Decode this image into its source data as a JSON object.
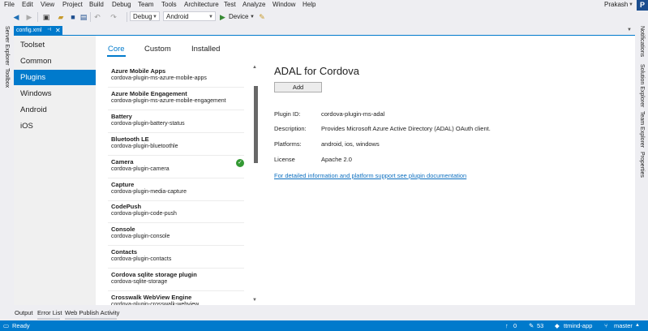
{
  "menu": [
    "File",
    "Edit",
    "View",
    "Project",
    "Build",
    "Debug",
    "Team",
    "Tools",
    "Architecture",
    "Test",
    "Analyze",
    "Window",
    "Help"
  ],
  "user": {
    "name": "Prakash",
    "badge": "P"
  },
  "toolbar": {
    "config": "Debug",
    "platform": "Android",
    "run_label": "Device"
  },
  "left_strip": [
    "Server Explorer",
    "Toolbox"
  ],
  "right_strip": [
    "Notifications",
    "Solution Explorer",
    "Team Explorer",
    "Properties"
  ],
  "doc_tab": {
    "label": "config.xml"
  },
  "categories": [
    "Toolset",
    "Common",
    "Plugins",
    "Windows",
    "Android",
    "iOS"
  ],
  "active_category": "Plugins",
  "tabs": [
    "Core",
    "Custom",
    "Installed"
  ],
  "plugins": [
    {
      "name": "Azure Mobile Apps",
      "id": "cordova-plugin-ms-azure-mobile-apps",
      "installed": false
    },
    {
      "name": "Azure Mobile Engagement",
      "id": "cordova-plugin-ms-azure-mobile-engagement",
      "installed": false
    },
    {
      "name": "Battery",
      "id": "cordova-plugin-battery-status",
      "installed": false
    },
    {
      "name": "Bluetooth LE",
      "id": "cordova-plugin-bluetoothle",
      "installed": false
    },
    {
      "name": "Camera",
      "id": "cordova-plugin-camera",
      "installed": true
    },
    {
      "name": "Capture",
      "id": "cordova-plugin-media-capture",
      "installed": false
    },
    {
      "name": "CodePush",
      "id": "cordova-plugin-code-push",
      "installed": false
    },
    {
      "name": "Console",
      "id": "cordova-plugin-console",
      "installed": false
    },
    {
      "name": "Contacts",
      "id": "cordova-plugin-contacts",
      "installed": false
    },
    {
      "name": "Cordova sqlite storage plugin",
      "id": "cordova-sqlite-storage",
      "installed": false
    },
    {
      "name": "Crosswalk WebView Engine",
      "id": "cordova-plugin-crosswalk-webview",
      "installed": false
    }
  ],
  "detail": {
    "title": "ADAL for Cordova",
    "add_label": "Add",
    "fields": [
      {
        "label": "Plugin ID:",
        "value": "cordova-plugin-ms-adal"
      },
      {
        "label": "Description:",
        "value": "Provides Microsoft Azure Active Directory (ADAL) OAuth client."
      },
      {
        "label": "Platforms:",
        "value": "android, ios, windows"
      },
      {
        "label": "License",
        "value": "Apache 2.0"
      }
    ],
    "link": "For detailed information and platform support see plugin documentation"
  },
  "bottom_tabs": [
    "Output",
    "Error List",
    "Web Publish Activity"
  ],
  "status": {
    "ready": "Ready",
    "up_count": "0",
    "edits": "53",
    "repo": "ttmind-app",
    "branch": "master"
  }
}
